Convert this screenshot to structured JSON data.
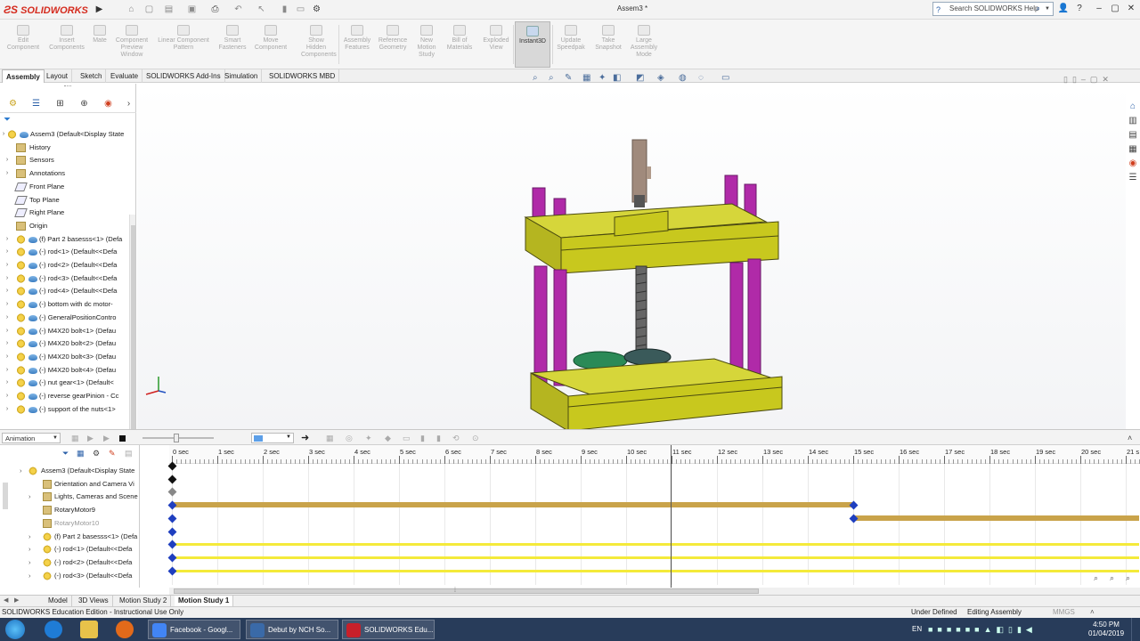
{
  "app": {
    "brand": "SOLIDWORKS",
    "doc_title": "Assem3 *"
  },
  "search": {
    "placeholder": "Search SOLIDWORKS Help"
  },
  "commands": [
    {
      "label": "Edit Component"
    },
    {
      "label": "Insert Components"
    },
    {
      "label": "Mate"
    },
    {
      "label": "Component Preview Window"
    },
    {
      "label": "Linear Component Pattern"
    },
    {
      "label": "Smart Fasteners"
    },
    {
      "label": "Move Component"
    },
    {
      "label": "Show Hidden Components"
    },
    {
      "label": "Assembly Features"
    },
    {
      "label": "Reference Geometry"
    },
    {
      "label": "New Motion Study"
    },
    {
      "label": "Bill of Materials"
    },
    {
      "label": "Exploded View"
    },
    {
      "label": "Instant3D"
    },
    {
      "label": "Update Speedpak"
    },
    {
      "label": "Take Snapshot"
    },
    {
      "label": "Large Assembly Mode"
    }
  ],
  "tabs": [
    "Assembly",
    "Layout",
    "Sketch",
    "Evaluate",
    "SOLIDWORKS Add-Ins",
    "Simulation",
    "SOLIDWORKS MBD"
  ],
  "feature_tree": [
    {
      "label": "Assem3  (Default<Display State",
      "icon": "assembly-icon",
      "indent": 0
    },
    {
      "label": "History",
      "icon": "history-icon",
      "indent": 1
    },
    {
      "label": "Sensors",
      "icon": "sensor-icon",
      "indent": 1
    },
    {
      "label": "Annotations",
      "icon": "annotations-icon",
      "indent": 1
    },
    {
      "label": "Front Plane",
      "icon": "plane-icon",
      "indent": 1
    },
    {
      "label": "Top Plane",
      "icon": "plane-icon",
      "indent": 1
    },
    {
      "label": "Right Plane",
      "icon": "plane-icon",
      "indent": 1
    },
    {
      "label": "Origin",
      "icon": "origin-icon",
      "indent": 1
    },
    {
      "label": "(f) Part 2 basesss<1> (Defa",
      "icon": "part-icon",
      "indent": 1
    },
    {
      "label": "(-) rod<1> (Default<<Defa",
      "icon": "part-icon",
      "indent": 1
    },
    {
      "label": "(-) rod<2> (Default<<Defa",
      "icon": "part-icon",
      "indent": 1
    },
    {
      "label": "(-) rod<3> (Default<<Defa",
      "icon": "part-icon",
      "indent": 1
    },
    {
      "label": "(-) rod<4> (Default<<Defa",
      "icon": "part-icon",
      "indent": 1
    },
    {
      "label": "(-) bottom with dc motor-",
      "icon": "part-icon",
      "indent": 1
    },
    {
      "label": "(-) GeneralPositionContro",
      "icon": "part-icon",
      "indent": 1
    },
    {
      "label": "(-) M4X20 bolt<1> (Defau",
      "icon": "part-icon",
      "indent": 1
    },
    {
      "label": "(-) M4X20 bolt<2> (Defau",
      "icon": "part-icon",
      "indent": 1
    },
    {
      "label": "(-) M4X20 bolt<3> (Defau",
      "icon": "part-icon",
      "indent": 1
    },
    {
      "label": "(-) M4X20 bolt<4> (Defau",
      "icon": "part-icon",
      "indent": 1
    },
    {
      "label": "(-) nut gear<1> (Default<",
      "icon": "part-icon",
      "indent": 1
    },
    {
      "label": "(-) reverse gearPinion - Cc",
      "icon": "part-icon",
      "indent": 1
    },
    {
      "label": "(-) support of the nuts<1>",
      "icon": "part-icon",
      "indent": 1
    }
  ],
  "motion": {
    "study_type": "Animation",
    "time_labels": [
      "0 sec",
      "1 sec",
      "2 sec",
      "3 sec",
      "4 sec",
      "5 sec",
      "6 sec",
      "7 sec",
      "8 sec",
      "9 sec",
      "10 sec",
      "11 sec",
      "12 sec",
      "13 sec",
      "14 sec",
      "15 sec",
      "16 sec",
      "17 sec",
      "18 sec",
      "19 sec",
      "20 sec",
      "21 s"
    ],
    "current_time_sec": 11,
    "tree": [
      {
        "label": "Assem3  (Default<Display State",
        "icon": "assembly-icon"
      },
      {
        "label": "Orientation and Camera Vi",
        "icon": "camera-icon"
      },
      {
        "label": "Lights, Cameras and Scene",
        "icon": "lights-icon"
      },
      {
        "label": "RotaryMotor9",
        "icon": "motor-icon"
      },
      {
        "label": "RotaryMotor10",
        "icon": "motor-icon"
      },
      {
        "label": "(f) Part 2 basesss<1> (Defa",
        "icon": "part-icon"
      },
      {
        "label": "(-) rod<1> (Default<<Defa",
        "icon": "part-icon"
      },
      {
        "label": "(-) rod<2> (Default<<Defa",
        "icon": "part-icon"
      },
      {
        "label": "(-) rod<3> (Default<<Defa",
        "icon": "part-icon"
      }
    ],
    "tracks": [
      {
        "row": 0,
        "keys": [
          {
            "t": 0,
            "kind": "black"
          }
        ]
      },
      {
        "row": 1,
        "keys": [
          {
            "t": 0,
            "kind": "black"
          }
        ]
      },
      {
        "row": 2,
        "keys": [
          {
            "t": 0,
            "kind": "grey"
          }
        ]
      },
      {
        "row": 3,
        "keys": [
          {
            "t": 0,
            "kind": "blue"
          },
          {
            "t": 15,
            "kind": "blue"
          }
        ],
        "bar": {
          "start": 0,
          "end": 15,
          "color": "brown"
        }
      },
      {
        "row": 4,
        "keys": [
          {
            "t": 0,
            "kind": "blue"
          },
          {
            "t": 15,
            "kind": "blue"
          }
        ],
        "bar": {
          "start": 15,
          "end": 21.3,
          "color": "brown"
        }
      },
      {
        "row": 5,
        "keys": [
          {
            "t": 0,
            "kind": "blue"
          }
        ]
      },
      {
        "row": 6,
        "keys": [
          {
            "t": 0,
            "kind": "blue"
          }
        ],
        "bar": {
          "start": 0,
          "end": 21.3,
          "color": "yellow"
        }
      },
      {
        "row": 7,
        "keys": [
          {
            "t": 0,
            "kind": "blue"
          }
        ],
        "bar": {
          "start": 0,
          "end": 21.3,
          "color": "yellow"
        }
      },
      {
        "row": 8,
        "keys": [
          {
            "t": 0,
            "kind": "blue"
          }
        ],
        "bar": {
          "start": 0,
          "end": 21.3,
          "color": "yellow"
        }
      }
    ]
  },
  "bottom_tabs": [
    "Model",
    "3D Views",
    "Motion Study 2",
    "Motion Study 1"
  ],
  "status": {
    "edition": "SOLIDWORKS Education Edition - Instructional Use Only",
    "definition": "Under Defined",
    "mode": "Editing Assembly",
    "units": "MMGS"
  },
  "taskbar": {
    "items": [
      {
        "label": "Facebook - Googl...",
        "color": "#4285f4"
      },
      {
        "label": "Debut by NCH So...",
        "color": "#3a6aa8"
      },
      {
        "label": "SOLIDWORKS Edu...",
        "color": "#c8202a"
      }
    ],
    "lang": "EN",
    "time": "4:50 PM",
    "date": "01/04/2019"
  },
  "colors": {
    "accent": "#d52b1e",
    "model_yellow": "#c8c81e",
    "rod_magenta": "#b02aa8",
    "gear_green": "#2b8a57",
    "motor_bar": "#c9a34a"
  }
}
